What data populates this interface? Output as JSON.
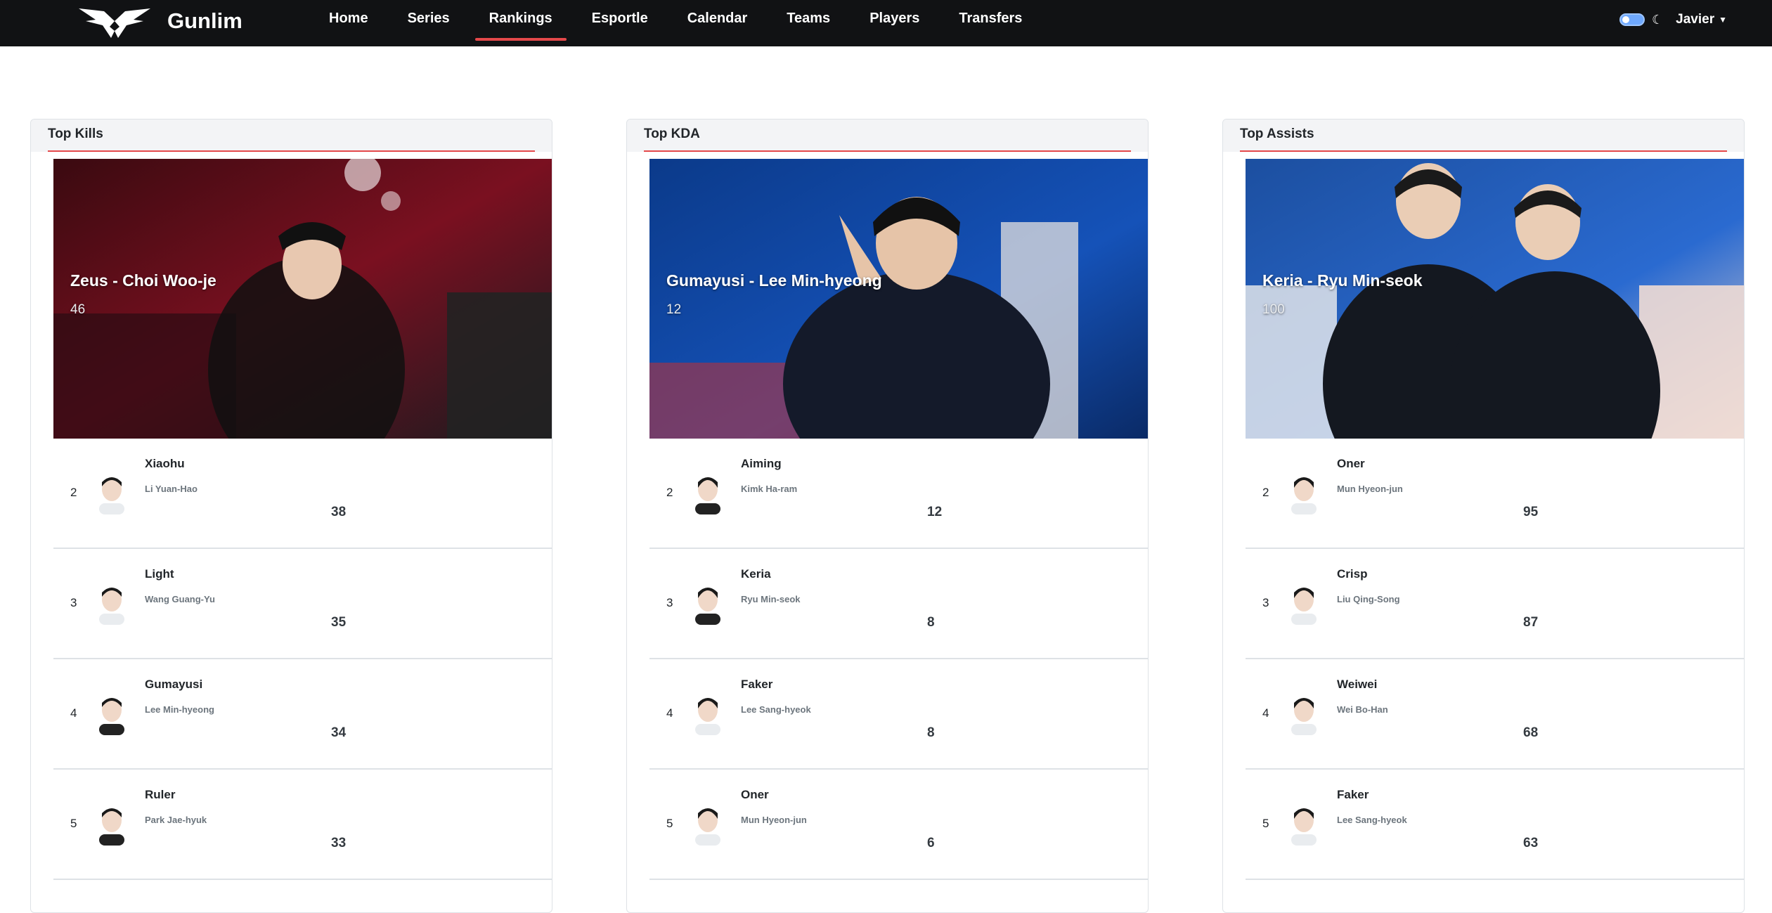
{
  "nav": {
    "brand": "Gunlim",
    "links": [
      {
        "label": "Home"
      },
      {
        "label": "Series"
      },
      {
        "label": "Rankings"
      },
      {
        "label": "Esportle"
      },
      {
        "label": "Calendar"
      },
      {
        "label": "Teams"
      },
      {
        "label": "Players"
      },
      {
        "label": "Transfers"
      }
    ],
    "active_link": "Rankings",
    "user": "Javier",
    "theme_toggle_icon": "toggle-switch",
    "theme_icon": "moon-icon"
  },
  "colors": {
    "navbar_bg": "#111214",
    "accent": "#e4484a",
    "card_header_bg": "#f3f4f6"
  },
  "cards": [
    {
      "title": "Top Kills",
      "hero": {
        "name": "Zeus - Choi Woo-je",
        "value": "46"
      },
      "rows": [
        {
          "rank": "2",
          "nick": "Xiaohu",
          "name": "Li Yuan-Hao",
          "value": "38"
        },
        {
          "rank": "3",
          "nick": "Light",
          "name": "Wang Guang-Yu",
          "value": "35"
        },
        {
          "rank": "4",
          "nick": "Gumayusi",
          "name": "Lee Min-hyeong",
          "value": "34"
        },
        {
          "rank": "5",
          "nick": "Ruler",
          "name": "Park Jae-hyuk",
          "value": "33"
        }
      ]
    },
    {
      "title": "Top KDA",
      "hero": {
        "name": "Gumayusi - Lee Min-hyeong",
        "value": "12"
      },
      "rows": [
        {
          "rank": "2",
          "nick": "Aiming",
          "name": "Kimk Ha-ram",
          "value": "12"
        },
        {
          "rank": "3",
          "nick": "Keria",
          "name": "Ryu Min-seok",
          "value": "8"
        },
        {
          "rank": "4",
          "nick": "Faker",
          "name": "Lee Sang-hyeok",
          "value": "8"
        },
        {
          "rank": "5",
          "nick": "Oner",
          "name": "Mun Hyeon-jun",
          "value": "6"
        }
      ]
    },
    {
      "title": "Top Assists",
      "hero": {
        "name": "Keria - Ryu Min-seok",
        "value": "100"
      },
      "rows": [
        {
          "rank": "2",
          "nick": "Oner",
          "name": "Mun Hyeon-jun",
          "value": "95"
        },
        {
          "rank": "3",
          "nick": "Crisp",
          "name": "Liu Qing-Song",
          "value": "87"
        },
        {
          "rank": "4",
          "nick": "Weiwei",
          "name": "Wei Bo-Han",
          "value": "68"
        },
        {
          "rank": "5",
          "nick": "Faker",
          "name": "Lee Sang-hyeok",
          "value": "63"
        }
      ]
    }
  ]
}
